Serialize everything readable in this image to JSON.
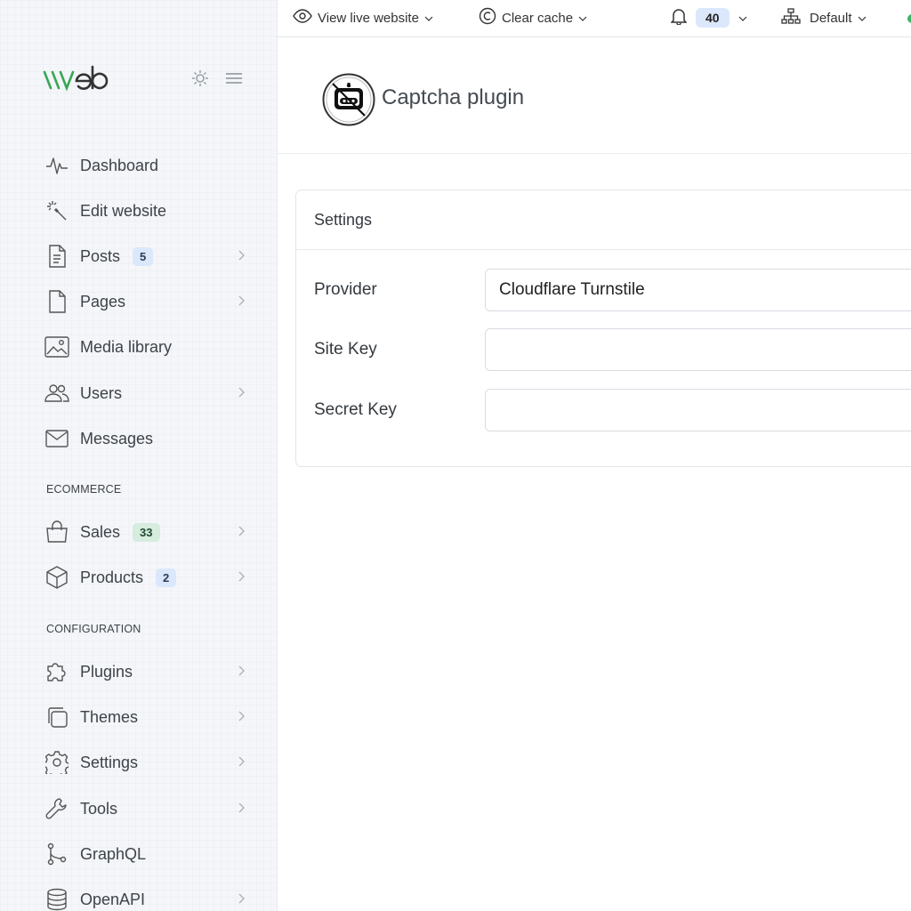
{
  "topbar": {
    "view_live": "View live website",
    "clear_cache": "Clear cache",
    "notifications_count": "40",
    "site_select": "Default"
  },
  "sidebar": {
    "items": [
      {
        "label": "Dashboard",
        "icon": "dashboard-pulse-icon"
      },
      {
        "label": "Edit website",
        "icon": "magic-wand-icon"
      },
      {
        "label": "Posts",
        "icon": "document-icon",
        "badge": "5"
      },
      {
        "label": "Pages",
        "icon": "page-icon"
      },
      {
        "label": "Media library",
        "icon": "image-icon"
      },
      {
        "label": "Users",
        "icon": "users-icon"
      },
      {
        "label": "Messages",
        "icon": "envelope-icon"
      }
    ],
    "ecommerce_title": "ECOMMERCE",
    "ecommerce_items": [
      {
        "label": "Sales",
        "icon": "shopping-bag-icon",
        "badge": "33"
      },
      {
        "label": "Products",
        "icon": "box-icon",
        "badge": "2"
      }
    ],
    "configuration_title": "CONFIGURATION",
    "configuration_items": [
      {
        "label": "Plugins",
        "icon": "puzzle-icon"
      },
      {
        "label": "Themes",
        "icon": "layers-icon"
      },
      {
        "label": "Settings",
        "icon": "gear-icon"
      },
      {
        "label": "Tools",
        "icon": "wrench-icon"
      },
      {
        "label": "GraphQL",
        "icon": "graph-icon"
      },
      {
        "label": "OpenAPI",
        "icon": "database-icon"
      }
    ]
  },
  "page": {
    "title": "Captcha plugin"
  },
  "settings_card": {
    "title": "Settings",
    "provider_label": "Provider",
    "provider_value": "Cloudflare Turnstile",
    "site_key_label": "Site Key",
    "site_key_value": "",
    "secret_key_label": "Secret Key",
    "secret_key_value": ""
  },
  "colors": {
    "brand_green": "#3aa655",
    "badge_blue": "#dbe7fb",
    "badge_green": "#d5ecdf"
  }
}
